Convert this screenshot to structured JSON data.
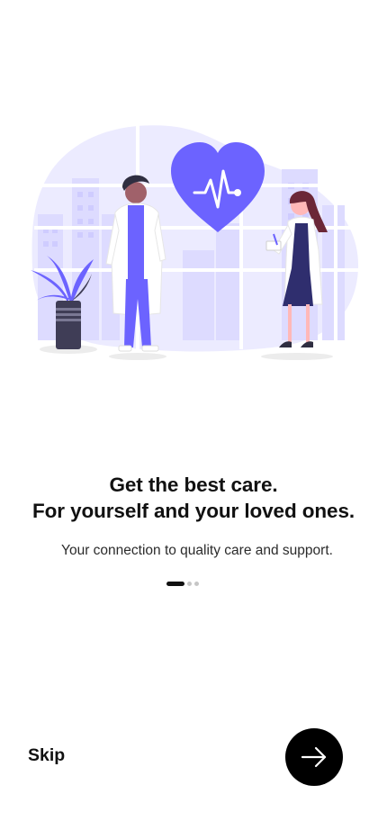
{
  "onboarding": {
    "headline_line1": "Get the best care.",
    "headline_line2": "For yourself and your loved ones.",
    "subtitle": "Your connection to quality care and support.",
    "page_index": 1,
    "page_count": 3
  },
  "actions": {
    "skip_label": "Skip",
    "next_icon": "arrow-right-icon"
  },
  "colors": {
    "accent": "#6c63ff",
    "accent_light": "#ecebff",
    "dark": "#111111",
    "dot_inactive": "#c6c6c6"
  },
  "illustration": {
    "subject": "doctors-with-heartbeat-heart-illustration"
  }
}
